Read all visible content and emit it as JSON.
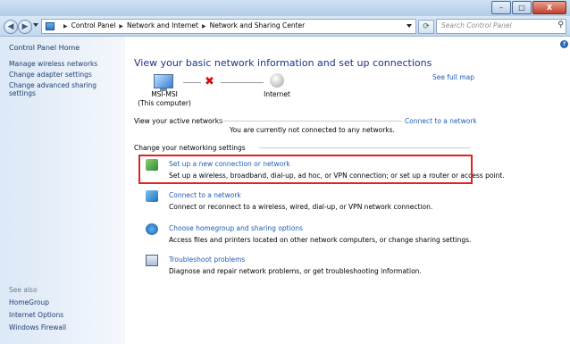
{
  "window": {
    "controls": [
      "–",
      "□",
      "X"
    ]
  },
  "address": {
    "crumbs": [
      "Control Panel",
      "Network and Internet",
      "Network and Sharing Center"
    ],
    "search_placeholder": "Search Control Panel"
  },
  "sidebar": {
    "home": "Control Panel Home",
    "links": [
      "Manage wireless networks",
      "Change adapter settings",
      "Change advanced sharing",
      "settings"
    ],
    "see_also_label": "See also",
    "see_also": [
      "HomeGroup",
      "Internet Options",
      "Windows Firewall"
    ]
  },
  "main": {
    "title": "View your basic network information and set up connections",
    "see_full_map": "See full map",
    "computer_name": "MSI-MSI",
    "computer_sub": "(This computer)",
    "internet_label": "Internet",
    "active_networks_label": "View your active networks",
    "connect_link": "Connect to a network",
    "not_connected": "You are currently not connected to any networks.",
    "change_settings_label": "Change your networking settings",
    "tasks": [
      {
        "title": "Set up a new connection or network",
        "desc": "Set up a wireless, broadband, dial-up, ad hoc, or VPN connection; or set up a router or access point."
      },
      {
        "title": "Connect to a network",
        "desc": "Connect or reconnect to a wireless, wired, dial-up, or VPN network connection."
      },
      {
        "title": "Choose homegroup and sharing options",
        "desc": "Access files and printers located on other network computers, or change sharing settings."
      },
      {
        "title": "Troubleshoot problems",
        "desc": "Diagnose and repair network problems, or get troubleshooting information."
      }
    ]
  },
  "icons": [
    "back-icon",
    "forward-icon",
    "control-panel-icon",
    "refresh-icon",
    "search-icon",
    "help-icon",
    "computer-icon",
    "globe-icon",
    "network-setup-icon",
    "connect-icon",
    "homegroup-icon",
    "troubleshoot-icon"
  ]
}
